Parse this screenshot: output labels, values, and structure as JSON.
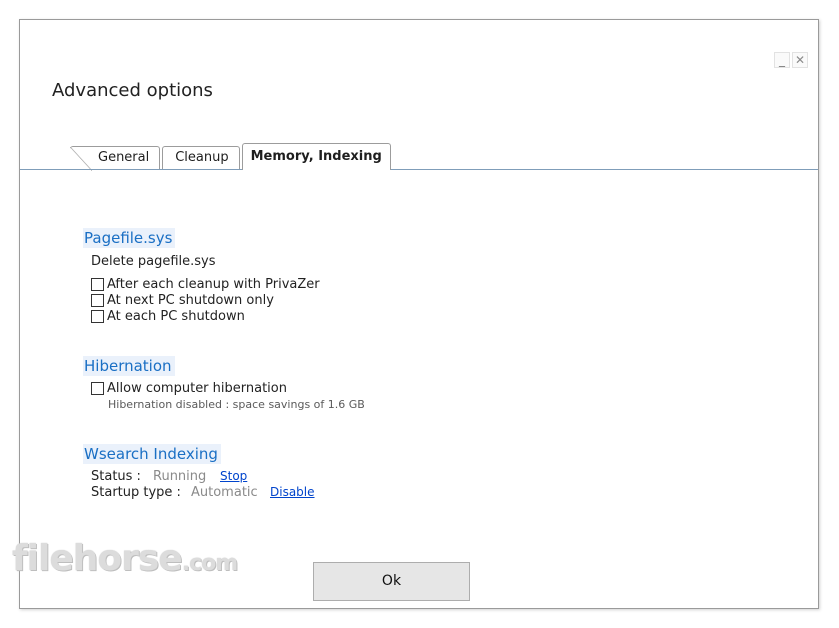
{
  "window": {
    "title": "Advanced options",
    "controls": {
      "minimize": "_",
      "close": "✕"
    }
  },
  "tabs": [
    {
      "label": "General"
    },
    {
      "label": "Cleanup"
    },
    {
      "label": "Memory, Indexing",
      "active": true
    }
  ],
  "pagefile": {
    "header": "Pagefile.sys",
    "subtitle": "Delete pagefile.sys",
    "options": [
      {
        "label": "After each cleanup with PrivaZer",
        "checked": false
      },
      {
        "label": "At next PC shutdown only",
        "checked": false
      },
      {
        "label": "At each PC shutdown",
        "checked": false
      }
    ]
  },
  "hibernation": {
    "header": "Hibernation",
    "option": {
      "label": "Allow computer hibernation",
      "checked": false
    },
    "note": "Hibernation disabled : space savings of 1.6 GB"
  },
  "wsearch": {
    "header": "Wsearch Indexing",
    "status_label": "Status :",
    "status_value": "Running",
    "status_action": "Stop",
    "startup_label": "Startup type :",
    "startup_value": "Automatic",
    "startup_action": "Disable"
  },
  "footer": {
    "ok_label": "Ok",
    "watermark": "filehorse",
    "watermark_suffix": ".com"
  },
  "colors": {
    "accent": "#1a6fc4",
    "link": "#0044cc",
    "tab_border": "#9c9c9c"
  }
}
